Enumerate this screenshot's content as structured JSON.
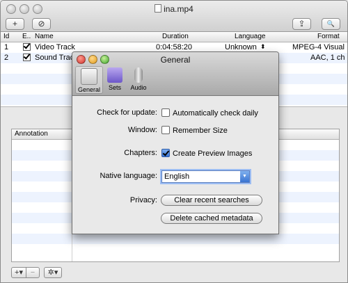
{
  "window": {
    "title": "ina.mp4"
  },
  "toolbar": {
    "add_label": "+",
    "remove_label": "⊘",
    "share_label": "⇪",
    "search_label": "🔍"
  },
  "columns": {
    "id": "Id",
    "enabled": "E..",
    "name": "Name",
    "duration": "Duration",
    "language": "Language",
    "format": "Format"
  },
  "tracks": [
    {
      "id": "1",
      "enabled": true,
      "name": "Video Track",
      "duration": "0:04:58:20",
      "language": "Unknown",
      "language_arrows": "⬍",
      "format": "MPEG-4 Visual"
    },
    {
      "id": "2",
      "enabled": true,
      "name": "Sound Track",
      "duration": "",
      "language": "",
      "format": "AAC, 1 ch"
    }
  ],
  "annotation": {
    "header": "Annotation"
  },
  "bottom": {
    "add_label": "+▾",
    "remove_label": "−",
    "gear_label": "✲▾"
  },
  "prefs": {
    "title": "General",
    "tabs": {
      "general": "General",
      "sets": "Sets",
      "audio": "Audio"
    },
    "check_update_label": "Check for update:",
    "check_update_option": "Automatically check daily",
    "check_update_checked": false,
    "window_label": "Window:",
    "window_option": "Remember Size",
    "window_checked": false,
    "chapters_label": "Chapters:",
    "chapters_option": "Create Preview Images",
    "chapters_checked": true,
    "native_language_label": "Native language:",
    "native_language_value": "English",
    "privacy_label": "Privacy:",
    "clear_searches_button": "Clear recent searches",
    "delete_metadata_button": "Delete cached metadata"
  },
  "colors": {
    "row_stripe": "#edf3fe",
    "accent": "#3a74d1"
  }
}
